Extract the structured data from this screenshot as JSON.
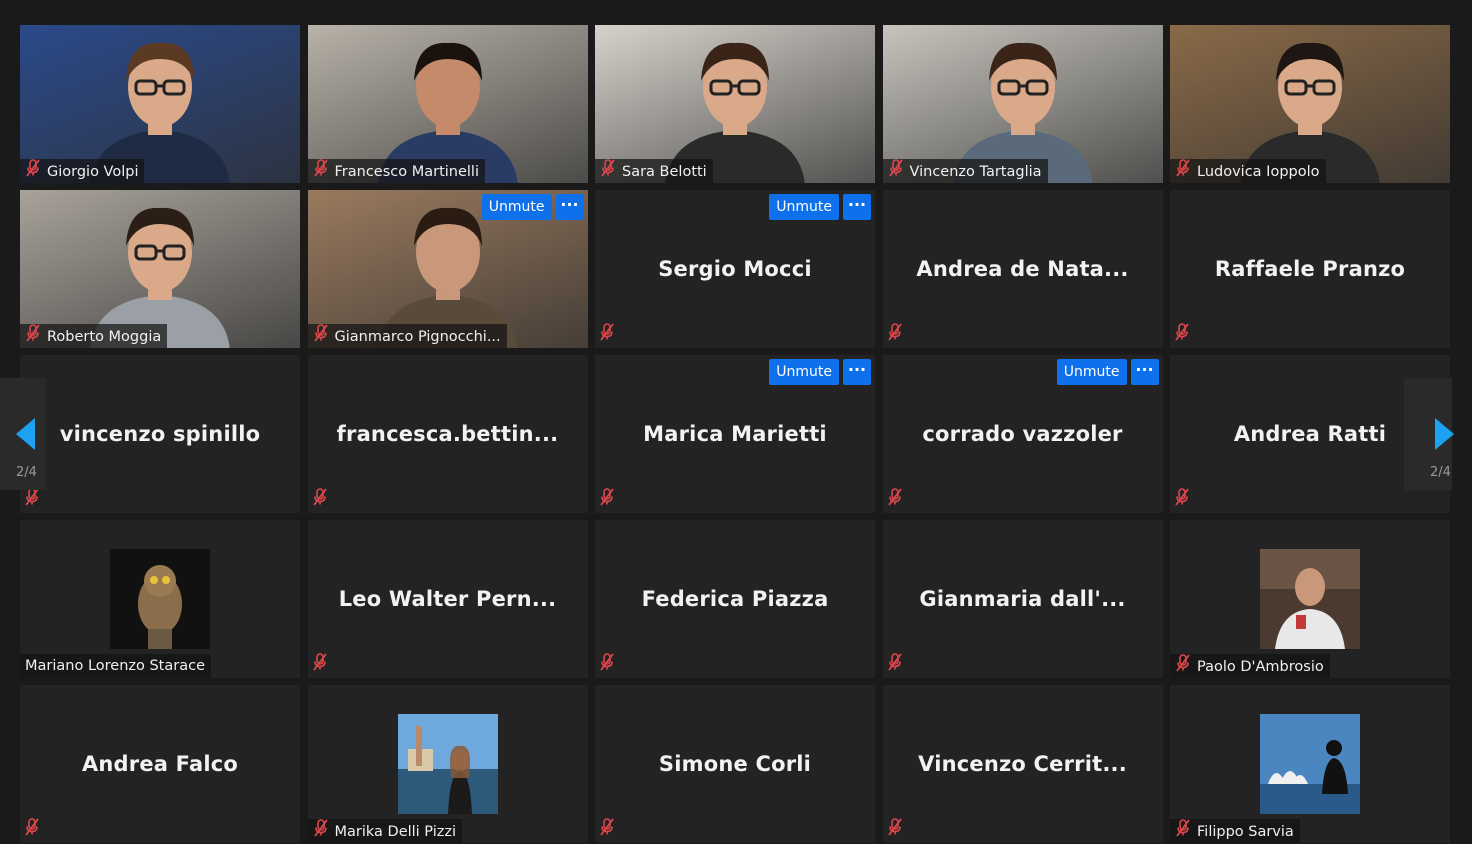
{
  "nav": {
    "prev_label": "2/4",
    "next_label": "2/4"
  },
  "participants": [
    {
      "name": "Giorgio Volpi",
      "video": true,
      "bg": "#2b4a8a"
    },
    {
      "name": "Francesco Martinelli",
      "video": true,
      "bg": "#b8b2a8"
    },
    {
      "name": "Sara Belotti",
      "video": true,
      "bg": "#d6d2cb"
    },
    {
      "name": "Vincenzo Tartaglia",
      "video": true,
      "bg": "#c7c4bd"
    },
    {
      "name": "Ludovica Ioppolo",
      "video": true,
      "bg": "#8a6a48"
    },
    {
      "name": "Roberto Moggia",
      "video": true,
      "bg": "#a8a29a"
    },
    {
      "name": "Gianmarco Pignocchi...",
      "video": true,
      "bg": "#9a7a5e",
      "unmute": "Unmute"
    },
    {
      "name": "Sergio Mocci",
      "video": false,
      "unmute": "Unmute"
    },
    {
      "name": "Andrea  de  Nata...",
      "video": false
    },
    {
      "name": "Raffaele Pranzo",
      "video": false
    },
    {
      "name": "vincenzo spinillo",
      "video": false
    },
    {
      "name": "francesca.bettin...",
      "video": false
    },
    {
      "name": "Marica Marietti",
      "video": false,
      "unmute": "Unmute"
    },
    {
      "name": "corrado vazzoler",
      "video": false,
      "unmute": "Unmute"
    },
    {
      "name": "Andrea Ratti",
      "video": false
    },
    {
      "name": "Mariano Lorenzo Starace",
      "video": false,
      "avatar": "owl",
      "unmuted": true
    },
    {
      "name": "Leo  Walter  Pern...",
      "video": false
    },
    {
      "name": "Federica Piazza",
      "video": false
    },
    {
      "name": "Gianmaria  dall'...",
      "video": false
    },
    {
      "name": "Paolo D'Ambrosio",
      "video": false,
      "avatar": "man"
    },
    {
      "name": "Andrea Falco",
      "video": false
    },
    {
      "name": "Marika Delli Pizzi",
      "video": false,
      "avatar": "venice"
    },
    {
      "name": "Simone Corli",
      "video": false
    },
    {
      "name": "Vincenzo  Cerrit...",
      "video": false
    },
    {
      "name": "Filippo Sarvia",
      "video": false,
      "avatar": "sydney"
    }
  ]
}
